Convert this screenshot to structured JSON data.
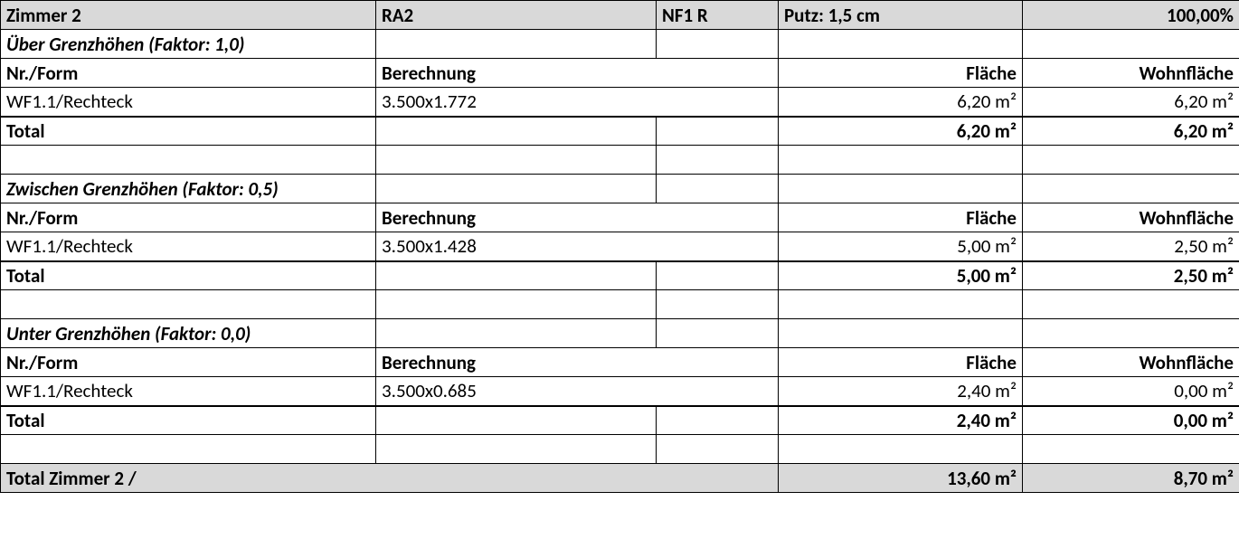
{
  "header": {
    "room": "Zimmer 2",
    "code": "RA2",
    "nf": "NF1 R",
    "putz": "Putz: 1,5 cm",
    "pct": "100,00%"
  },
  "sections": [
    {
      "title": "Über Grenzhöhen (Faktor: 1,0)",
      "col_nr": "Nr./Form",
      "col_calc": "Berechnung",
      "col_area": "Fläche",
      "col_wohn": "Wohnfläche",
      "row_nr": "WF1.1/Rechteck",
      "row_calc": "3.500x1.772",
      "row_area": "6,20 m²",
      "row_wohn": "6,20 m²",
      "total_label": "Total",
      "total_area": "6,20 m²",
      "total_wohn": "6,20 m²"
    },
    {
      "title": "Zwischen Grenzhöhen (Faktor: 0,5)",
      "col_nr": "Nr./Form",
      "col_calc": "Berechnung",
      "col_area": "Fläche",
      "col_wohn": "Wohnfläche",
      "row_nr": "WF1.1/Rechteck",
      "row_calc": "3.500x1.428",
      "row_area": "5,00 m²",
      "row_wohn": "2,50 m²",
      "total_label": "Total",
      "total_area": "5,00 m²",
      "total_wohn": "2,50 m²"
    },
    {
      "title": "Unter Grenzhöhen (Faktor: 0,0)",
      "col_nr": "Nr./Form",
      "col_calc": "Berechnung",
      "col_area": "Fläche",
      "col_wohn": "Wohnfläche",
      "row_nr": "WF1.1/Rechteck",
      "row_calc": "3.500x0.685",
      "row_area": "2,40 m²",
      "row_wohn": "0,00 m²",
      "total_label": "Total",
      "total_area": "2,40 m²",
      "total_wohn": "0,00 m²"
    }
  ],
  "grand": {
    "label": "Total Zimmer 2 /",
    "area": "13,60 m²",
    "wohn": "8,70 m²"
  }
}
